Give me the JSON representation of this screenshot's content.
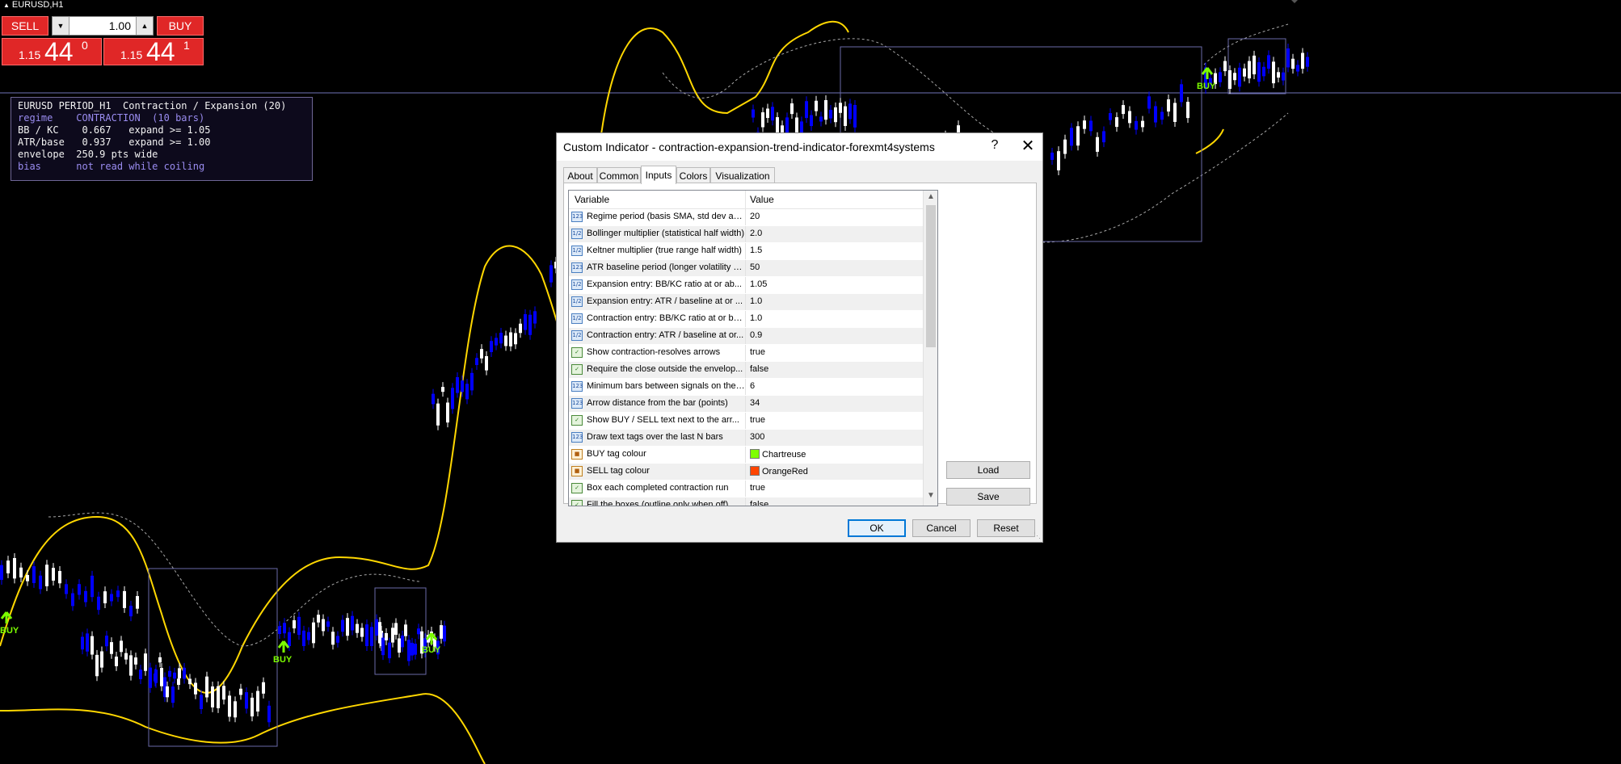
{
  "chart": {
    "symbol": "EURUSD,H1",
    "colors": {
      "bull": "#ffffff",
      "bear": "#0000ff",
      "bands": "#ffd700",
      "keltner": "#a8a8a8",
      "box": "#6a6aa8",
      "signal": "#7cfc00",
      "hline": "#6f73b7"
    },
    "signals": [
      {
        "label": "BUY"
      },
      {
        "label": "BUY"
      },
      {
        "label": "BUY"
      },
      {
        "label": "BUY"
      }
    ]
  },
  "trade_panel": {
    "sell_label": "SELL",
    "buy_label": "BUY",
    "lot": "1.00",
    "sell_price_prefix": "1.15",
    "sell_price_big": "44",
    "sell_price_sup": "0",
    "buy_price_prefix": "1.15",
    "buy_price_big": "44",
    "buy_price_sup": "1"
  },
  "info_panel": {
    "header": "EURUSD PERIOD_H1  Contraction / Expansion (20)",
    "lines": [
      {
        "label": "regime  ",
        "value": "  CONTRACTION  (10 bars)",
        "accent": true
      },
      {
        "label": "BB / KC ",
        "value": "   0.667   expand >= 1.05",
        "accent": false
      },
      {
        "label": "ATR/base",
        "value": "   0.937   expand >= 1.00",
        "accent": false
      },
      {
        "label": "envelope",
        "value": "  250.9 pts wide",
        "accent": false
      },
      {
        "label": "bias    ",
        "value": "  not read while coiling",
        "accent": true
      }
    ]
  },
  "dialog": {
    "title": "Custom Indicator - contraction-expansion-trend-indicator-forexmt4systems",
    "help": "?",
    "close": "✕",
    "tabs": [
      "About",
      "Common",
      "Inputs",
      "Colors",
      "Visualization"
    ],
    "active_tab": "Inputs",
    "columns": {
      "variable": "Variable",
      "value": "Value"
    },
    "params": [
      {
        "type": "int",
        "name": "Regime period (basis SMA, std dev an...",
        "value": "20"
      },
      {
        "type": "dbl",
        "name": "Bollinger multiplier (statistical half width)",
        "value": "2.0"
      },
      {
        "type": "dbl",
        "name": "Keltner multiplier (true range half width)",
        "value": "1.5"
      },
      {
        "type": "int",
        "name": "ATR baseline period (longer volatility a...",
        "value": "50"
      },
      {
        "type": "dbl",
        "name": "Expansion entry: BB/KC ratio at or ab...",
        "value": "1.05"
      },
      {
        "type": "dbl",
        "name": "Expansion entry: ATR / baseline at or ...",
        "value": "1.0"
      },
      {
        "type": "dbl",
        "name": "Contraction entry: BB/KC ratio at or be...",
        "value": "1.0"
      },
      {
        "type": "dbl",
        "name": "Contraction entry: ATR / baseline at or...",
        "value": "0.9"
      },
      {
        "type": "bool",
        "name": "Show contraction-resolves arrows",
        "value": "true"
      },
      {
        "type": "bool",
        "name": "Require the close outside the envelop...",
        "value": "false"
      },
      {
        "type": "int",
        "name": "Minimum bars between signals on the s...",
        "value": "6"
      },
      {
        "type": "int",
        "name": "Arrow distance from the bar (points)",
        "value": "34"
      },
      {
        "type": "bool",
        "name": "Show BUY / SELL text next to the arr...",
        "value": "true"
      },
      {
        "type": "int",
        "name": "Draw text tags over the last N bars",
        "value": "300"
      },
      {
        "type": "color",
        "name": "BUY tag colour",
        "value": "Chartreuse",
        "swatch": "#7fff00"
      },
      {
        "type": "color",
        "name": "SELL tag colour",
        "value": "OrangeRed",
        "swatch": "#ff4500"
      },
      {
        "type": "bool",
        "name": "Box each completed contraction run",
        "value": "true"
      },
      {
        "type": "bool",
        "name": "Fill the boxes (outline only when off)",
        "value": "false"
      }
    ],
    "side_buttons": {
      "load": "Load",
      "save": "Save"
    },
    "buttons": {
      "ok": "OK",
      "cancel": "Cancel",
      "reset": "Reset"
    }
  }
}
